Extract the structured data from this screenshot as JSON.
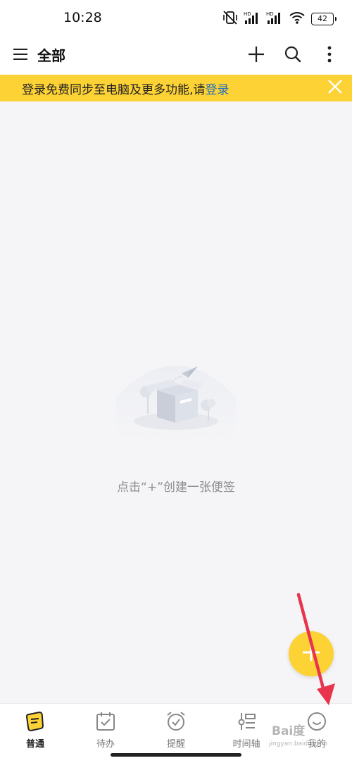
{
  "status_bar": {
    "time": "10:28",
    "battery": "42",
    "hd_label": "HD",
    "icons": [
      "vibrate-off-icon",
      "signal-icon",
      "signal-icon",
      "wifi-icon",
      "battery-icon"
    ]
  },
  "app_bar": {
    "title": "全部",
    "icons": [
      "menu-icon",
      "plus-icon",
      "search-icon",
      "more-vertical-icon"
    ]
  },
  "banner": {
    "text": "登录免费同步至电脑及更多功能,请",
    "link": "登录",
    "close_icon": "close-icon"
  },
  "empty_state": {
    "message": "点击“+”创建一张便签",
    "illustration": "empty-box-icon"
  },
  "fab": {
    "icon": "plus-icon"
  },
  "bottom_nav": {
    "items": [
      {
        "label": "普通",
        "icon": "note-icon",
        "active": true
      },
      {
        "label": "待办",
        "icon": "todo-icon",
        "active": false
      },
      {
        "label": "提醒",
        "icon": "alarm-icon",
        "active": false
      },
      {
        "label": "时间轴",
        "icon": "timeline-icon",
        "active": false
      },
      {
        "label": "我的",
        "icon": "smile-icon",
        "active": false
      }
    ]
  },
  "colors": {
    "accent": "#fdd235",
    "link": "#1f6fbf",
    "background": "#f5f5f7",
    "annotation": "#e8354d"
  },
  "watermark": {
    "text": "Bai度",
    "sub": "jingyan.baidu.com"
  }
}
